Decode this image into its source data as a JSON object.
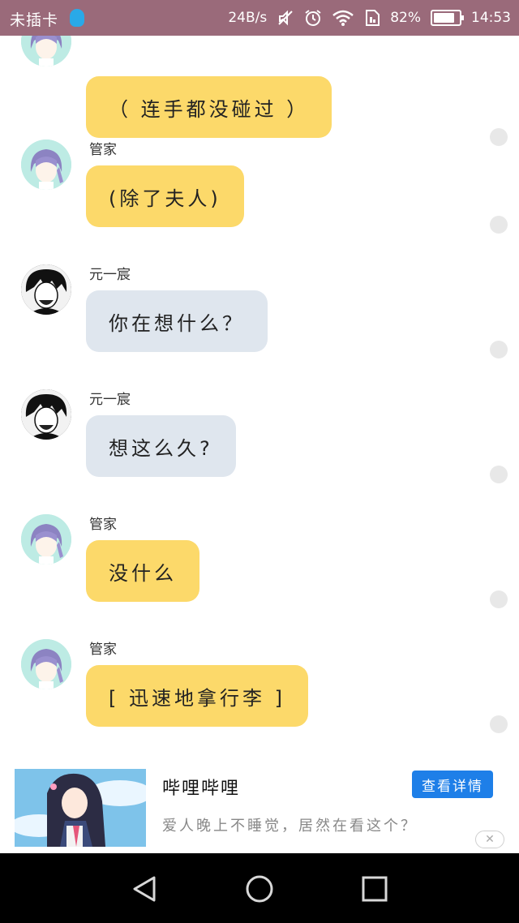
{
  "status_bar": {
    "carrier": "未插卡",
    "network_speed": "24B/s",
    "battery_percent": "82%",
    "battery_level": 0.82,
    "time": "14:53",
    "icons": [
      "qq-icon",
      "mute-icon",
      "alarm-icon",
      "wifi-icon",
      "sim-icon",
      "battery-icon"
    ]
  },
  "messages": [
    {
      "sender": "",
      "text": "（ 连手都没碰过 ）",
      "style": "yellow",
      "avatar": "girl-avatar"
    },
    {
      "sender": "管家",
      "text": "(除了夫人)",
      "style": "yellow",
      "avatar": "girl-avatar"
    },
    {
      "sender": "元一宸",
      "text": "你在想什么？",
      "style": "gray",
      "avatar": "boy-avatar"
    },
    {
      "sender": "元一宸",
      "text": "想这么久?",
      "style": "gray",
      "avatar": "boy-avatar"
    },
    {
      "sender": "管家",
      "text": "没什么",
      "style": "yellow",
      "avatar": "girl-avatar"
    },
    {
      "sender": "管家",
      "text": "[ 迅速地拿行李 ]",
      "style": "yellow",
      "avatar": "girl-avatar"
    }
  ],
  "ad": {
    "title": "哔哩哔哩",
    "description": "爱人晚上不睡觉，居然在看这个？",
    "button_label": "查看详情",
    "close_icon": "close-icon",
    "accent_color": "#1e7fe8"
  },
  "nav_bar": {
    "buttons": [
      "back-icon",
      "home-icon",
      "recents-icon"
    ]
  },
  "colors": {
    "status_bar": "#9a6a7a",
    "bubble_yellow": "#fcd96a",
    "bubble_gray": "#dfe6ee"
  }
}
